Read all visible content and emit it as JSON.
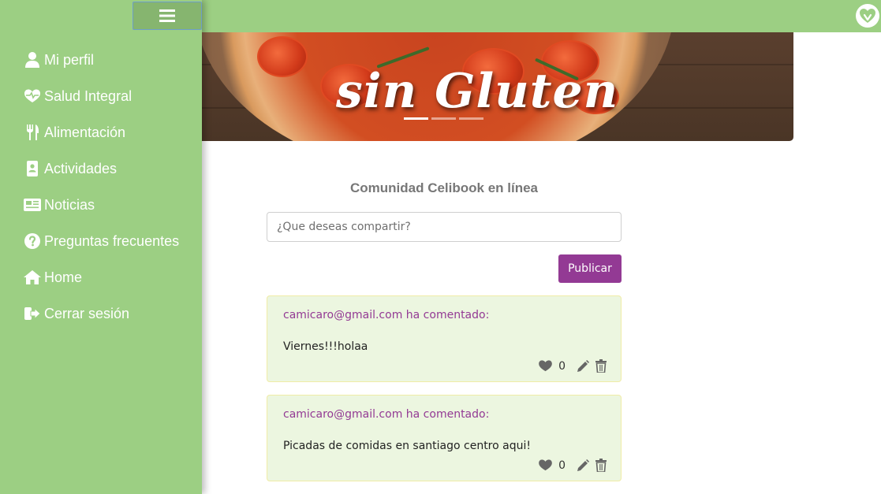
{
  "header": {
    "logo_icon": "heart-leaf-logo-icon"
  },
  "hero": {
    "title_line2": "sin Gluten",
    "slides": 3,
    "active_slide": 1
  },
  "sidebar": {
    "toggle_icon": "hamburger-menu-icon",
    "items": [
      {
        "label": "Mi perfil",
        "icon": "user-icon"
      },
      {
        "label": "Salud Integral",
        "icon": "heartbeat-icon"
      },
      {
        "label": "Alimentación",
        "icon": "utensils-icon"
      },
      {
        "label": "Actividades",
        "icon": "address-book-icon"
      },
      {
        "label": "Noticias",
        "icon": "newspaper-icon"
      },
      {
        "label": "Preguntas frecuentes",
        "icon": "question-circle-icon"
      },
      {
        "label": "Home",
        "icon": "home-icon"
      },
      {
        "label": "Cerrar sesión",
        "icon": "sign-out-icon"
      }
    ]
  },
  "main": {
    "title": "Comunidad Celibook en línea",
    "input_placeholder": "¿Que deseas compartir?",
    "publish_label": "Publicar"
  },
  "posts": [
    {
      "author": "camicaro@gmail.com ha comentado:",
      "body": "Viernes!!!holaa",
      "likes": "0"
    },
    {
      "author": "camicaro@gmail.com ha comentado:",
      "body": "Picadas de comidas en santiago centro aqui!",
      "likes": "0"
    }
  ],
  "colors": {
    "sidebar": "#9ccf83",
    "accent": "#933a94",
    "post_bg": "#ecf6e0",
    "text_muted": "#777777"
  }
}
